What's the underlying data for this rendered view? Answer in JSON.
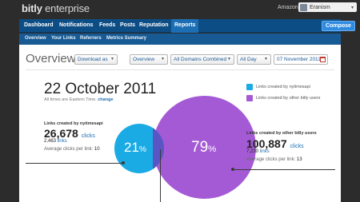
{
  "brand": {
    "name_bold": "bitly",
    "name_rest": " enterprise"
  },
  "account": {
    "org": "Amazon",
    "user": "Eranism",
    "caret": "▾"
  },
  "nav": {
    "items": [
      "Dashboard",
      "Notifications",
      "Feeds",
      "Posts",
      "Reputation",
      "Reports"
    ],
    "active": "Reports",
    "compose": "Compose"
  },
  "subnav": {
    "items": [
      "Overview",
      "Your Links",
      "Referrers",
      "Metrics Summary"
    ]
  },
  "page": {
    "title": "Overview",
    "download": "Download as",
    "view_select": "Overview",
    "domain_select": "All Domains Combined",
    "time_select": "All Day",
    "date_input": "07 November 2011"
  },
  "report": {
    "date": "22 October 2011",
    "timezone_text": "All times are Eastern Time.",
    "timezone_link": "change"
  },
  "legend": [
    {
      "label": "Links created by nytimesapi",
      "color": "#1aabe5"
    },
    {
      "label": "Links created by other bitly users",
      "color": "#a55ad5"
    }
  ],
  "stats": {
    "left": {
      "label": "Links created by nytimesapi",
      "clicks": "26,678",
      "clicks_unit": "clicks",
      "links": "2,463",
      "links_unit": "links",
      "avg_label": "Average clicks per link:",
      "avg_value": "10",
      "percent": "21",
      "percent_sign": "%"
    },
    "right": {
      "label": "Links created by other bitly users",
      "clicks": "100,887",
      "clicks_unit": "clicks",
      "links": "7,230",
      "links_unit": "links",
      "avg_label": "Average clicks per link:",
      "avg_value": "13",
      "percent": "79",
      "percent_sign": "%"
    }
  },
  "colors": {
    "nav": "#0d4d85",
    "accent": "#1d6fb5",
    "nytimes": "#1aabe5",
    "others": "#a55ad5"
  }
}
